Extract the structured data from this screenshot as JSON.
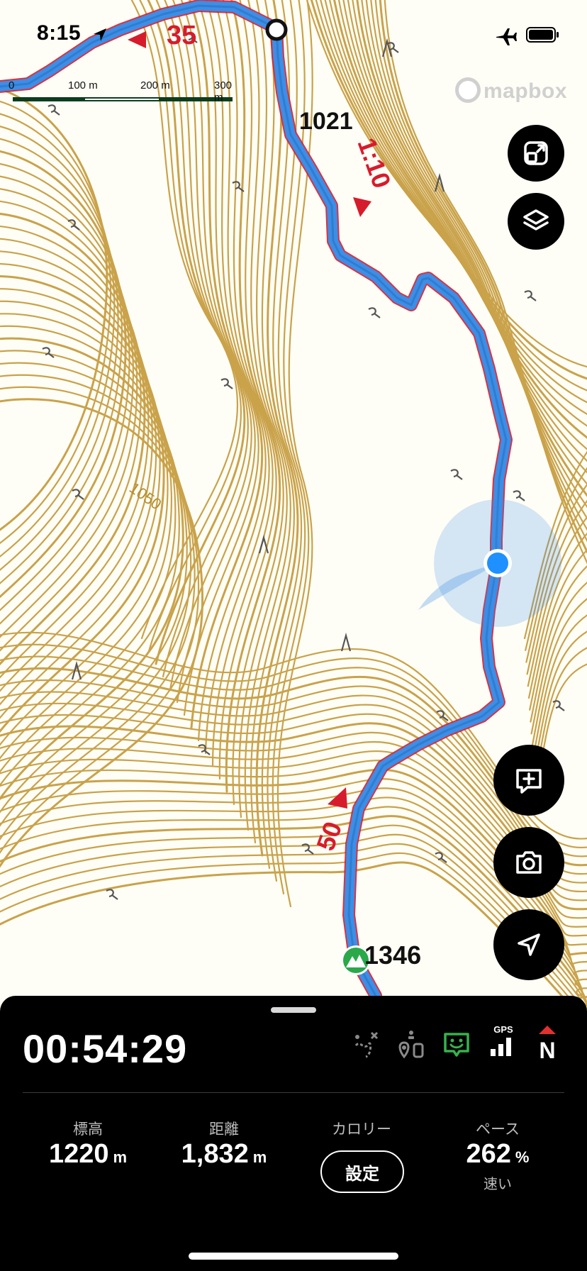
{
  "status_bar": {
    "time": "8:15"
  },
  "map": {
    "scale_labels": [
      "0",
      "100 m",
      "200 m",
      "300 m"
    ],
    "attribution": "mapbox",
    "peak_1021": "1021",
    "peak_1346": "1346",
    "contour_1050": "1050",
    "route_time_1": "35",
    "route_time_2": "1:10",
    "route_time_3": "50",
    "colors": {
      "contour": "#c9a24a",
      "route": "#3c8ee6",
      "route_edge": "#d61c2c",
      "location": "#1e90ff",
      "map_bg": "#fffef6"
    }
  },
  "buttons": {
    "resize_icon": "resize-icon",
    "layers_icon": "layers-icon",
    "add_note_icon": "add-note-icon",
    "camera_icon": "camera-icon",
    "navigate_icon": "navigation-arrow-icon"
  },
  "panel": {
    "elapsed": "00:54:29",
    "indicators": {
      "gps_label": "GPS",
      "compass_label": "N"
    },
    "stats": {
      "elevation": {
        "label": "標高",
        "value": "1220",
        "unit": "m"
      },
      "distance": {
        "label": "距離",
        "value": "1,832",
        "unit": "m"
      },
      "calories": {
        "label": "カロリー",
        "button": "設定"
      },
      "pace": {
        "label": "ペース",
        "value": "262",
        "unit": "%",
        "sub": "速い"
      }
    }
  }
}
